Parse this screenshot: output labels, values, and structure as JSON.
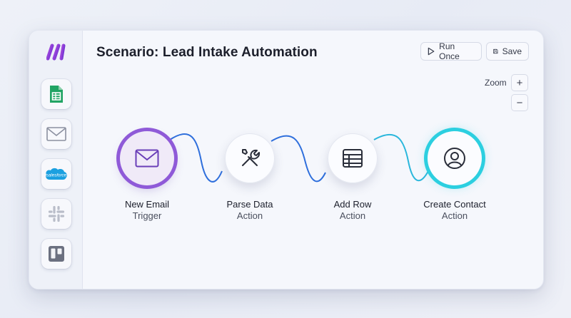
{
  "header": {
    "title": "Scenario: Lead Intake Automation",
    "run_once_label": "Run Once",
    "save_label": "Save"
  },
  "zoom": {
    "label": "Zoom",
    "in_symbol": "+",
    "out_symbol": "−"
  },
  "sidebar": {
    "logo_icon": "make-logo-icon",
    "apps": [
      {
        "name": "google-sheets",
        "icon": "sheets-icon"
      },
      {
        "name": "email",
        "icon": "mail-icon"
      },
      {
        "name": "salesforce",
        "icon": "salesforce-icon",
        "text": "salesforce"
      },
      {
        "name": "slack",
        "icon": "slack-icon"
      },
      {
        "name": "trello",
        "icon": "trello-icon"
      }
    ]
  },
  "flow": {
    "nodes": [
      {
        "title": "New Email",
        "subtitle": "Trigger",
        "icon": "envelope-icon"
      },
      {
        "title": "Parse Data",
        "subtitle": "Action",
        "icon": "tools-icon"
      },
      {
        "title": "Add Row",
        "subtitle": "Action",
        "icon": "table-icon"
      },
      {
        "title": "Create Contact",
        "subtitle": "Action",
        "icon": "user-circle-icon"
      }
    ]
  },
  "colors": {
    "trigger_ring": "#8f5ad8",
    "final_ring": "#2ccfe0",
    "connector": "#2f6fdc"
  }
}
